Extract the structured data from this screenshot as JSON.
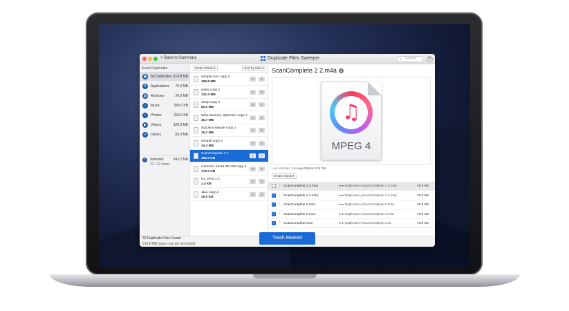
{
  "window": {
    "title": "Duplicate Files Sweeper",
    "back_label": "< Back to Summary",
    "search_placeholder": "Search",
    "traffic_lights": [
      "#fc605c",
      "#fdbc40",
      "#34c84a"
    ]
  },
  "sidebar": {
    "heading": "Exact Duplicates",
    "items": [
      {
        "label": "All Duplicates",
        "size": "514.8 MB",
        "icon": "stack-icon",
        "glyph": "▣"
      },
      {
        "label": "Applications",
        "size": "76.9 MB",
        "icon": "apps-icon",
        "glyph": "A"
      },
      {
        "label": "Archives",
        "size": "24.3 MB",
        "icon": "archive-icon",
        "glyph": "▤"
      },
      {
        "label": "Music",
        "size": "380.0 KB",
        "icon": "music-icon",
        "glyph": "♪"
      },
      {
        "label": "Photos",
        "size": "256.0 KB",
        "icon": "photo-icon",
        "glyph": "▪"
      },
      {
        "label": "Videos",
        "size": "329.9 MB",
        "icon": "video-icon",
        "glyph": "▶"
      },
      {
        "label": "Others",
        "size": "83.0 MB",
        "icon": "others-icon",
        "glyph": "≡"
      }
    ],
    "selected_label": "Selected",
    "selected_count": "22 / 32 items",
    "selected_size": "343.2 MB"
  },
  "list": {
    "filter_label": "Smart Check ▾",
    "sort_label": "Sort by Size ▾",
    "items": [
      {
        "name": "sample.mov copy 2",
        "size": "159.9 MB",
        "a": "2",
        "b": "3"
      },
      {
        "name": "video copy 2",
        "size": "121.0 MB",
        "a": "2",
        "b": "3"
      },
      {
        "name": "setup copy 2",
        "size": "83.0 MB",
        "a": "3",
        "b": "4"
      },
      {
        "name": "Wise Memory Optimizer copy 2",
        "size": "36.7 MB",
        "a": "2",
        "b": "3"
      },
      {
        "name": "SQLite Example copy 2",
        "size": "36.2 MB",
        "a": "2",
        "b": "3"
      },
      {
        "name": "sample copy 2",
        "size": "24.3 MB",
        "a": "2",
        "b": "3"
      },
      {
        "name": "ScanComplete 2 2",
        "size": "380.0 KB",
        "a": "4",
        "b": "5"
      },
      {
        "name": "Cartoon1 18-55-35-738 copy 2",
        "size": "179.0 KB",
        "a": "2",
        "b": "3"
      },
      {
        "name": "ico_DPS 2 2",
        "size": "2.4 KB",
        "a": "2",
        "b": "3"
      },
      {
        "name": "1111 copy 2",
        "size": "29.0 KB",
        "a": "2",
        "b": "3"
      }
    ]
  },
  "detail": {
    "filename": "ScanComplete 2 2.m4a",
    "preview_caption": "MPEG 4",
    "last_modified_label": "Last Modified:",
    "last_modified_value": "15-Aug-2018 at 4:01 PM",
    "filter_label": "Smart Check ▾",
    "rows": [
      {
        "checked": false,
        "name": "ScanComplete 2 2.m4a",
        "path": "▸ ▸ Duplicate ▸ ScanComplete 2 2.m4a",
        "size": "76.0 KB"
      },
      {
        "checked": true,
        "name": "ScanComplete 2 2.m4a",
        "path": "▸ ▸ Duplicate ▸ ScanComplete 2 2.m4a",
        "size": "76.0 KB"
      },
      {
        "checked": true,
        "name": "ScanComplete 2.m4a",
        "path": "▸ ▸ Duplicate ▸ ScanComplete 2.m4a",
        "size": "76.0 KB"
      },
      {
        "checked": true,
        "name": "ScanComplete 3.m4a",
        "path": "▸ ▸ Duplicate ▸ ScanComplete 3.m4a",
        "size": "76.0 KB"
      },
      {
        "checked": true,
        "name": "ScanComplete.m4a",
        "path": "▸ ▸ Duplicate ▸ ScanComplete.m4a",
        "size": "76.0 KB"
      }
    ]
  },
  "footer": {
    "found": "32 Duplicate Files Found",
    "recoverable": "514.8 MB space can be recovered",
    "trash_label": "Trash Marked"
  },
  "colors": {
    "accent": "#1c6ad6",
    "sidebar_icon": "#1b5fa8"
  }
}
